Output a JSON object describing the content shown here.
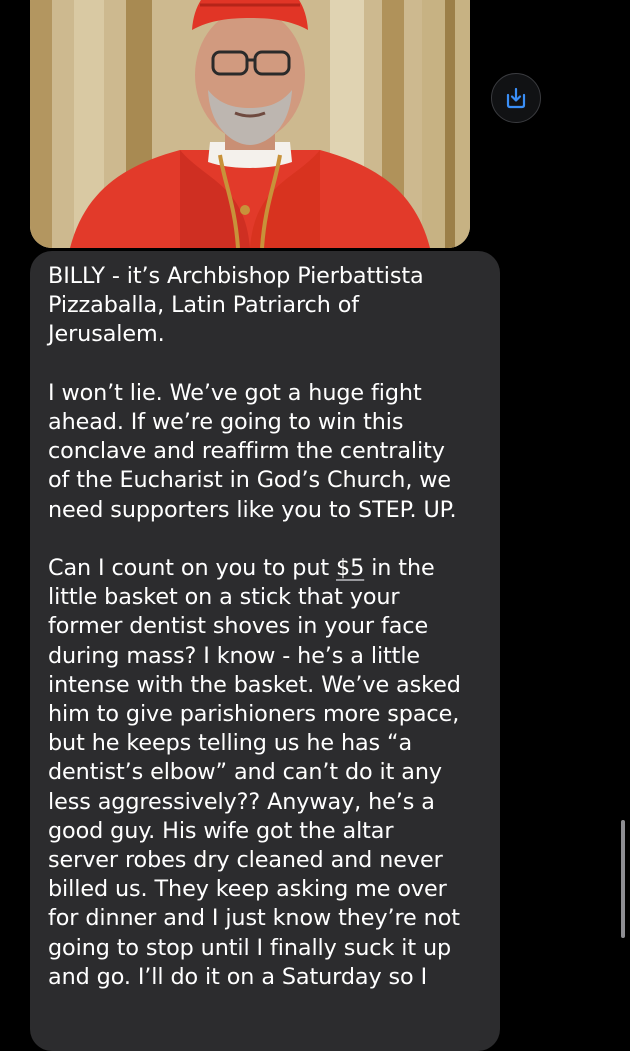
{
  "conversation": {
    "image_message": {
      "description_icon": "photo-attachment",
      "save_icon": "save-download-icon",
      "accent_color": "#3a8ef6"
    },
    "text_message": {
      "paragraph_1": "BILLY - it’s Archbishop Pierbattista\nPizzaballa, Latin Patriarch of\nJerusalem.",
      "paragraph_2": "I won’t lie. We’ve got a huge fight\nahead. If we’re going to win this\nconclave and reaffirm the centrality\nof the Eucharist in God’s Church, we\nneed supporters like you to STEP. UP.",
      "paragraph_3_before_link": "Can I count on you to put ",
      "paragraph_3_link": "$5",
      "paragraph_3_after_link": " in the\nlittle basket on a stick that your\nformer dentist shoves in your face\nduring mass? I know - he’s a little\nintense with the basket. We’ve asked\nhim to give parishioners more space,\nbut he keeps telling us he has “a\ndentist’s elbow” and can’t do it any\nless aggressively?? Anyway, he’s a\ngood guy. His wife got the altar\nserver robes dry cleaned and never\nbilled us. They keep asking me over\nfor dinner and I just know they’re not\ngoing to stop until I finally suck it up\nand go. I’ll do it on a Saturday so I",
      "bubble_color": "#2c2c2e",
      "text_color": "#ffffff"
    }
  },
  "scrollbar": {
    "color": "#8e8e93"
  }
}
